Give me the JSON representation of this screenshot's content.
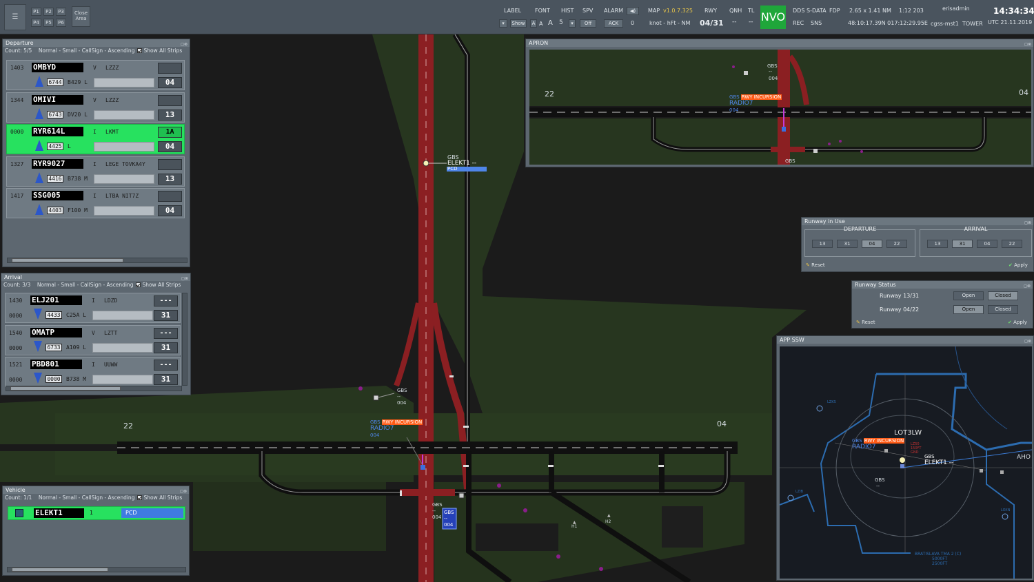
{
  "toolbar": {
    "menu_icon": "menu-icon",
    "presets": [
      "P1",
      "P2",
      "P3",
      "P4",
      "P5",
      "P6"
    ],
    "close_area": "Close Area",
    "label": {
      "title": "LABEL",
      "value": "▾"
    },
    "font": {
      "title": "FONT",
      "show": "Show",
      "sizes": [
        "A",
        "A",
        "A"
      ]
    },
    "hist": {
      "title": "HIST",
      "value": "5"
    },
    "spv": {
      "title": "SPV",
      "value": "Off"
    },
    "alarm": {
      "title": "ALARM",
      "ack": "ACK",
      "count": "0"
    },
    "map": {
      "title": "MAP",
      "version": "v1.0.7.325",
      "units": "knot - hFt - NM"
    },
    "rwy": {
      "title": "RWY",
      "value": "04/31"
    },
    "qnh": {
      "title": "QNH",
      "value": "--"
    },
    "tl": {
      "title": "TL",
      "value": "--"
    },
    "nvo": "NVO",
    "dds": "DDS",
    "sdata": "S-DATA",
    "fdp": "FDP",
    "rec": "REC",
    "sns": "SNS",
    "range": "2.65 x 1.41 NM",
    "scale": "1:12 203",
    "coords": "48:10:17.39N 017:12:29.95E",
    "user": "erisadmin",
    "host": "cgss-mst1",
    "role": "TOWER",
    "time": "14:34:34",
    "date": "UTC 21.11.2019"
  },
  "departure": {
    "title": "Departure",
    "subtitle": "Count: 5/5",
    "mode": "Normal - Small - CallSign - Ascending",
    "show_all": "Show All Strips",
    "strips": [
      {
        "time": "1403",
        "callsign": "OMBYD",
        "rule": "V",
        "dest": "LZZZ",
        "box1": "",
        "code": "6744",
        "ac": "B429 L",
        "rwy": "04",
        "selected": false
      },
      {
        "time": "1344",
        "callsign": "OMIVI",
        "rule": "V",
        "dest": "LZZZ",
        "box1": "",
        "code": "6743",
        "ac": "DV20 L",
        "rwy": "13",
        "selected": false
      },
      {
        "time": "0000",
        "callsign": "RYR614L",
        "rule": "I",
        "dest": "LKMT",
        "box1": "1A",
        "code": "4425",
        "ac": "L",
        "rwy": "04",
        "selected": true
      },
      {
        "time": "1327",
        "callsign": "RYR9027",
        "rule": "I",
        "dest": "LEGE  TOVKA4Y",
        "box1": "",
        "code": "4416",
        "ac": "B738 M",
        "rwy": "13",
        "selected": false
      },
      {
        "time": "1417",
        "callsign": "SSG005",
        "rule": "I",
        "dest": "LTBA  NIT7Z",
        "box1": "",
        "code": "4403",
        "ac": "F100 M",
        "rwy": "04",
        "selected": false
      }
    ]
  },
  "arrival": {
    "title": "Arrival",
    "subtitle": "Count: 3/3",
    "mode": "Normal - Small - CallSign - Ascending",
    "show_all": "Show All Strips",
    "strips": [
      {
        "time": "1430",
        "time2": "0000",
        "callsign": "ELJ201",
        "rule": "I",
        "dest": "LDZD",
        "box1": "---",
        "code": "4433",
        "ac": "C25A L",
        "rwy": "31"
      },
      {
        "time": "1540",
        "time2": "0000",
        "callsign": "OMATP",
        "rule": "V",
        "dest": "LZTT",
        "box1": "---",
        "code": "6733",
        "ac": "A109 L",
        "rwy": "31"
      },
      {
        "time": "1521",
        "time2": "0000",
        "callsign": "PBD801",
        "rule": "I",
        "dest": "UUWW",
        "box1": "---",
        "code": "0000",
        "ac": "B738 M",
        "rwy": "31"
      }
    ]
  },
  "vehicle": {
    "title": "Vehicle",
    "subtitle": "Count: 1/1",
    "mode": "Normal - Small - CallSign - Ascending",
    "show_all": "Show All Strips",
    "strip": {
      "callsign": "ELEKT1",
      "num": "1",
      "type": "PCD"
    }
  },
  "apron": {
    "title": "APRON",
    "rwy_left": "22",
    "rwy_right": "04",
    "gbs1": "GBS",
    "gbs1_dash": "--",
    "gbs1_num": "004",
    "incursion_prefix": "GBS",
    "incursion": "RWY INCURSION",
    "radio": "RADIO7",
    "radio_num": "004",
    "gbs2": "GBS"
  },
  "runway_in_use": {
    "title": "Runway in Use",
    "departure_label": "DEPARTURE",
    "arrival_label": "ARRIVAL",
    "departure": [
      "13",
      "31",
      "04",
      "22"
    ],
    "departure_active": "04",
    "arrival": [
      "13",
      "31",
      "04",
      "22"
    ],
    "arrival_active": "31",
    "reset": "Reset",
    "apply": "Apply"
  },
  "runway_status": {
    "title": "Runway Status",
    "rows": [
      {
        "name": "Runway  13/31",
        "open": "Open",
        "closed": "Closed",
        "active": "Closed"
      },
      {
        "name": "Runway  04/22",
        "open": "Open",
        "closed": "Closed",
        "active": "Open"
      }
    ],
    "reset": "Reset",
    "apply": "Apply"
  },
  "app_ssw": {
    "title": "APP SSW",
    "lot": "LOT3LW",
    "incursion_prefix": "GBS",
    "incursion": "RWY INCURSION",
    "radio": "RADIO7",
    "gbs_a": "GBS",
    "elekt": "ELEKT1 --",
    "gbs_b": "GBS",
    "gbs_b_dash": "--",
    "aho": "AHO",
    "tma": "BRATISLAVA TMA 2 (C)",
    "tma_alt1": "5000FT",
    "tma_alt2": "2500FT",
    "lzks": "LZKS",
    "lzib": "LZIB",
    "loxn": "LOXN",
    "lzm": "LZ50",
    "lzm2": "150FT",
    "lzm3": "GND"
  },
  "main_map": {
    "rwy_left": "22",
    "rwy_right": "04",
    "elekt_gbs": "GBS",
    "elekt_call": "ELEKT1 --",
    "elekt_pcd": "PCD",
    "gbs_a": "GBS",
    "gbs_a_dash": "--",
    "gbs_a_num": "004",
    "incursion_prefix": "GBS",
    "incursion": "RWY INCURSION",
    "radio": "RADIO7",
    "radio_num": "004",
    "gbs_b": "GBS",
    "gbs_b_dash": "--",
    "gbs_b_num": "004",
    "gbs_c": "GBS",
    "gbs_c_dash": "--",
    "gbs_c_num": "004",
    "h1": "H1",
    "h2": "H2"
  },
  "colors": {
    "runway_active": "#8b1f22",
    "grass": "#27361f",
    "taxiway": "#141414",
    "incursion": "#ff5a14",
    "strip_selected": "#27e15f",
    "nvo": "#1fa63a"
  }
}
